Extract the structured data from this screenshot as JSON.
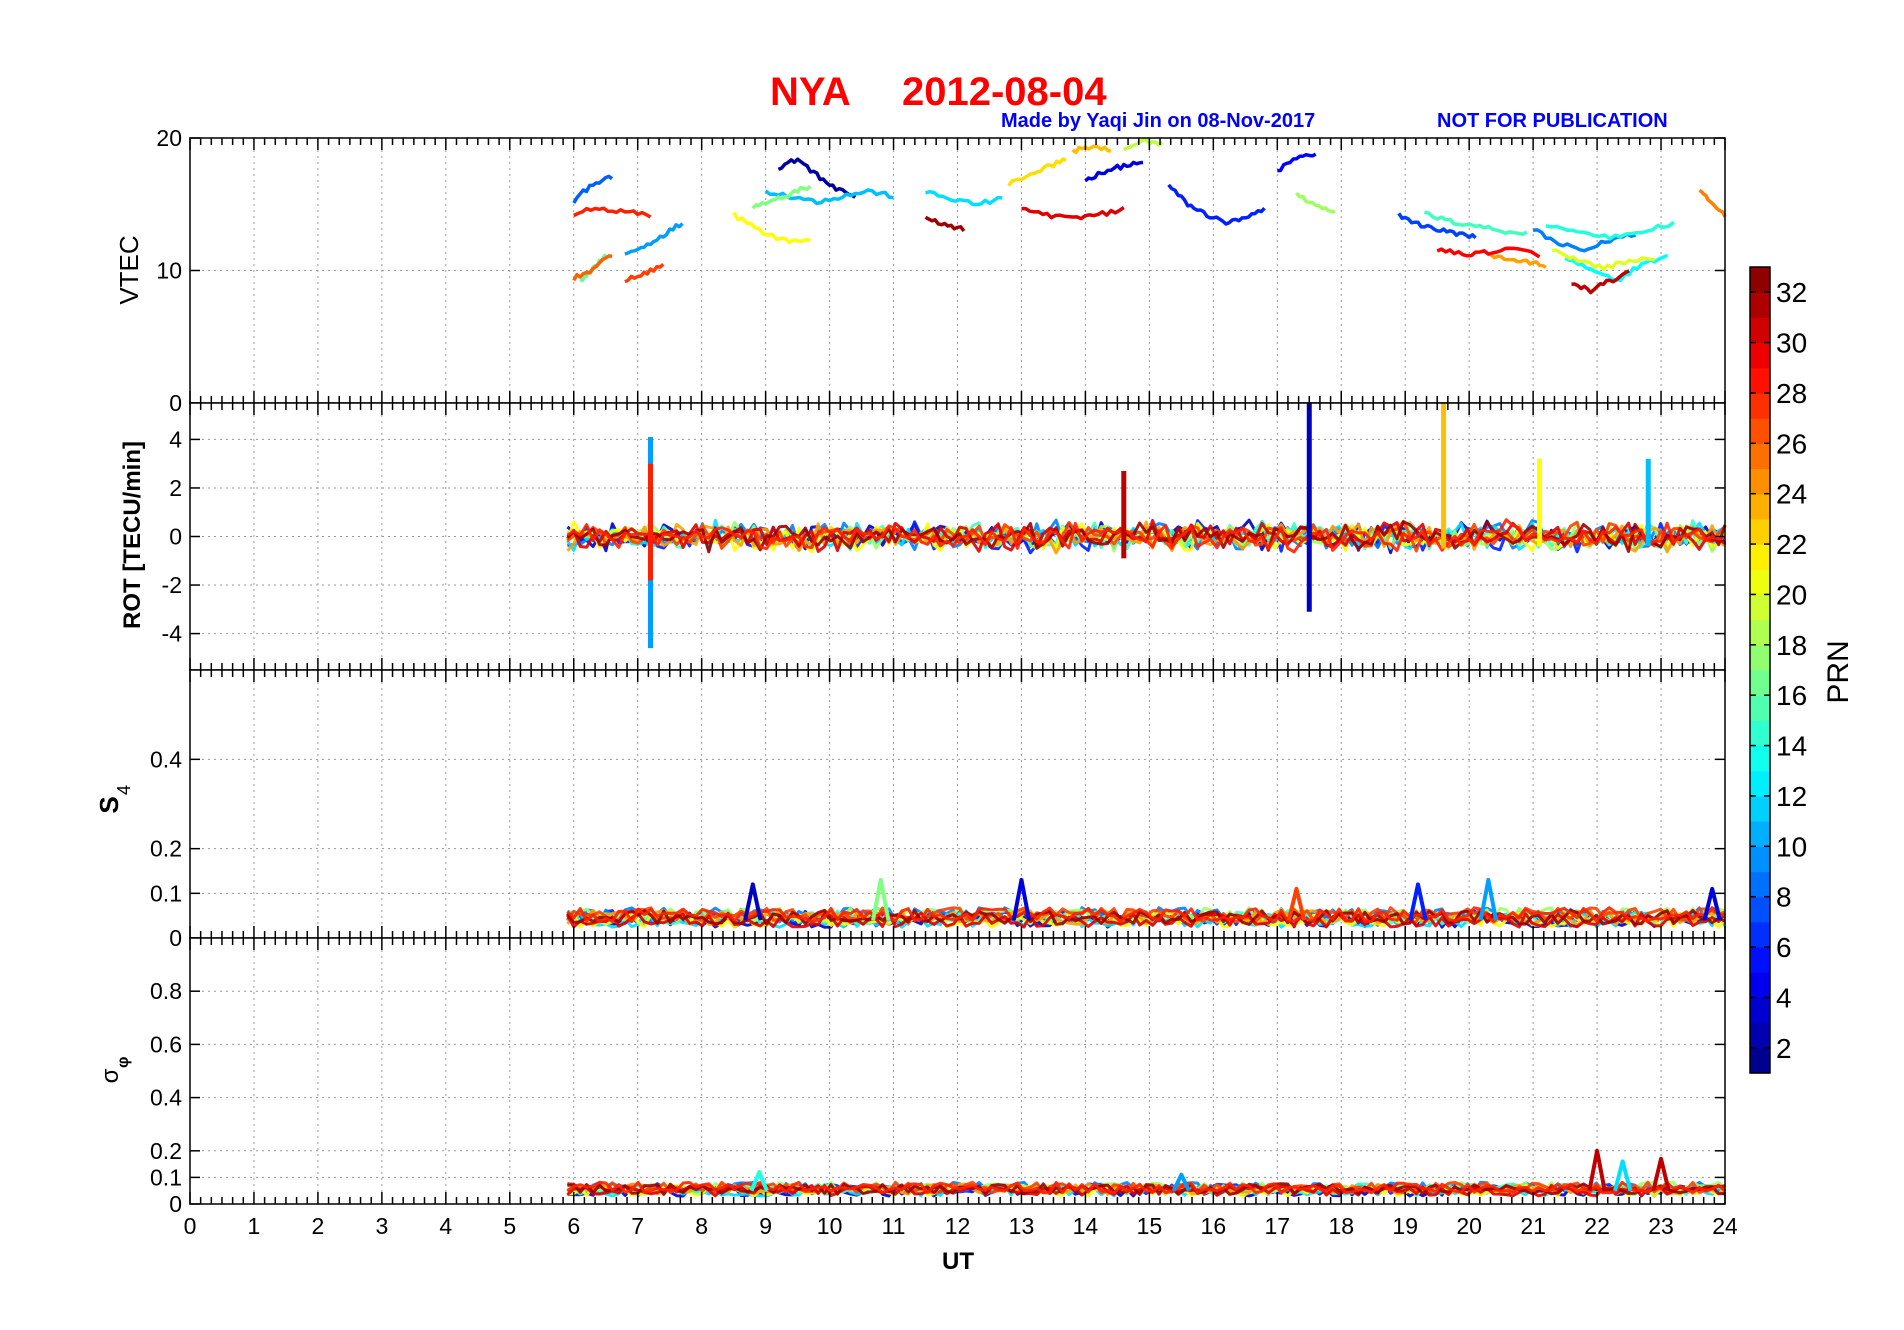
{
  "title": {
    "station": "NYA",
    "date": "2012-08-04",
    "credit": "Made by Yaqi Jin on 08-Nov-2017",
    "notice": "NOT FOR PUBLICATION"
  },
  "colors": {
    "title": "#ff0000",
    "credit": "#0000ff",
    "grid": "#9a9a9a",
    "axis": "#000000"
  },
  "colormap": "jet",
  "chart_data": [
    {
      "type": "line",
      "id": "vtec",
      "ylabel": "VTEC",
      "xlim": [
        0,
        24
      ],
      "ylim": [
        0,
        20
      ],
      "yticks": [
        "0",
        "10",
        "20"
      ],
      "ytick_values": [
        0,
        10,
        20
      ],
      "grid": true,
      "series_color_by": "PRN",
      "series": [
        {
          "prn": 2,
          "x": [
            9.2,
            9.5,
            9.8,
            10.1,
            10.4
          ],
          "y": [
            17.8,
            18.4,
            17.2,
            16.1,
            15.6
          ]
        },
        {
          "prn": 4,
          "x": [
            14.0,
            14.3,
            14.6,
            14.9
          ],
          "y": [
            16.8,
            17.5,
            17.9,
            18.1
          ]
        },
        {
          "prn": 5,
          "x": [
            17.0,
            17.3,
            17.6
          ],
          "y": [
            17.5,
            18.5,
            18.8
          ]
        },
        {
          "prn": 6,
          "x": [
            15.3,
            15.6,
            15.9,
            16.2,
            16.5,
            16.8
          ],
          "y": [
            16.4,
            15.0,
            14.2,
            13.6,
            13.9,
            14.6
          ]
        },
        {
          "prn": 7,
          "x": [
            18.9,
            19.2,
            19.5,
            19.8,
            20.1
          ],
          "y": [
            14.2,
            13.5,
            13.1,
            12.8,
            12.5
          ]
        },
        {
          "prn": 8,
          "x": [
            6.0,
            6.3,
            6.6
          ],
          "y": [
            15.2,
            16.6,
            17.0
          ]
        },
        {
          "prn": 9,
          "x": [
            21.0,
            21.4,
            21.8,
            22.2,
            22.6
          ],
          "y": [
            13.1,
            12.0,
            11.5,
            12.3,
            12.8
          ]
        },
        {
          "prn": 10,
          "x": [
            6.8,
            7.1,
            7.4,
            7.7
          ],
          "y": [
            11.2,
            11.8,
            12.7,
            13.6
          ]
        },
        {
          "prn": 11,
          "x": [
            9.0,
            9.4,
            9.8,
            10.2,
            10.6,
            11.0
          ],
          "y": [
            16.0,
            15.6,
            15.2,
            15.6,
            16.0,
            15.6
          ]
        },
        {
          "prn": 12,
          "x": [
            11.5,
            11.9,
            12.3,
            12.7
          ],
          "y": [
            15.9,
            15.4,
            15.0,
            15.4
          ]
        },
        {
          "prn": 13,
          "x": [
            21.5,
            21.9,
            22.3,
            22.7,
            23.1
          ],
          "y": [
            11.0,
            10.0,
            9.2,
            10.5,
            11.0
          ]
        },
        {
          "prn": 14,
          "x": [
            21.2,
            21.7,
            22.2,
            22.7,
            23.2
          ],
          "y": [
            13.5,
            12.9,
            12.5,
            13.0,
            13.5
          ]
        },
        {
          "prn": 15,
          "x": [
            19.3,
            19.7,
            20.1,
            20.5,
            20.9
          ],
          "y": [
            14.3,
            13.7,
            13.4,
            13.0,
            12.8
          ]
        },
        {
          "prn": 16,
          "x": [
            6.1,
            6.3,
            6.5
          ],
          "y": [
            9.2,
            10.1,
            11.2
          ]
        },
        {
          "prn": 17,
          "x": [
            8.8,
            9.1,
            9.4,
            9.7
          ],
          "y": [
            14.8,
            15.2,
            15.8,
            16.4
          ]
        },
        {
          "prn": 18,
          "x": [
            17.3,
            17.6,
            17.9
          ],
          "y": [
            15.8,
            14.8,
            14.4
          ]
        },
        {
          "prn": 19,
          "x": [
            14.6,
            14.9,
            15.2
          ],
          "y": [
            19.0,
            19.8,
            19.6
          ]
        },
        {
          "prn": 20,
          "x": [
            21.3,
            21.7,
            22.1,
            22.5,
            22.9
          ],
          "y": [
            11.6,
            10.8,
            10.2,
            10.7,
            11.0
          ]
        },
        {
          "prn": 21,
          "x": [
            8.5,
            8.9,
            9.3,
            9.7
          ],
          "y": [
            14.2,
            13.0,
            12.3,
            12.2
          ]
        },
        {
          "prn": 22,
          "x": [
            12.8,
            13.1,
            13.4,
            13.7
          ],
          "y": [
            16.5,
            17.2,
            17.8,
            18.4
          ]
        },
        {
          "prn": 23,
          "x": [
            13.8,
            14.1,
            14.4
          ],
          "y": [
            19.0,
            19.4,
            19.0
          ]
        },
        {
          "prn": 24,
          "x": [
            20.3,
            20.6,
            20.9,
            21.2
          ],
          "y": [
            11.2,
            10.9,
            10.6,
            10.4
          ]
        },
        {
          "prn": 25,
          "x": [
            23.6,
            23.8,
            24.0
          ],
          "y": [
            16.0,
            15.0,
            14.2
          ]
        },
        {
          "prn": 26,
          "x": [
            6.0,
            6.3,
            6.6
          ],
          "y": [
            9.4,
            10.1,
            11.2
          ]
        },
        {
          "prn": 27,
          "x": [
            6.8,
            7.1,
            7.4
          ],
          "y": [
            9.3,
            9.7,
            10.4
          ]
        },
        {
          "prn": 28,
          "x": [
            6.0,
            6.4,
            6.8,
            7.2
          ],
          "y": [
            14.3,
            14.7,
            14.4,
            14.2
          ]
        },
        {
          "prn": 29,
          "x": [
            19.5,
            19.9,
            20.3,
            20.7,
            21.1
          ],
          "y": [
            11.6,
            11.2,
            11.4,
            11.6,
            11.2
          ]
        },
        {
          "prn": 30,
          "x": [
            13.0,
            13.4,
            13.8,
            14.2,
            14.6
          ],
          "y": [
            14.6,
            14.2,
            13.9,
            14.2,
            14.6
          ]
        },
        {
          "prn": 31,
          "x": [
            21.6,
            21.9,
            22.2,
            22.5
          ],
          "y": [
            9.0,
            8.5,
            9.2,
            9.8
          ]
        },
        {
          "prn": 32,
          "x": [
            11.5,
            11.8,
            12.1
          ],
          "y": [
            13.9,
            13.5,
            13.1
          ]
        }
      ]
    },
    {
      "type": "line",
      "id": "rot",
      "ylabel": "ROT [TECU/min]",
      "xlim": [
        0,
        24
      ],
      "ylim": [
        -5.5,
        5.5
      ],
      "yticks": [
        "-4",
        "-2",
        "0",
        "2",
        "4"
      ],
      "ytick_values": [
        -4,
        -2,
        0,
        2,
        4
      ],
      "grid": true,
      "data_x_range": [
        5.9,
        24
      ],
      "noise_amplitude": 0.5,
      "spikes": [
        {
          "x": 7.2,
          "ymin": -4.6,
          "ymax": 4.1,
          "prn": 10
        },
        {
          "x": 7.2,
          "ymin": -1.8,
          "ymax": 3.0,
          "prn": 28
        },
        {
          "x": 14.6,
          "ymin": -0.9,
          "ymax": 2.7,
          "prn": 31
        },
        {
          "x": 17.5,
          "ymin": -3.1,
          "ymax": 5.5,
          "prn": 3
        },
        {
          "x": 19.6,
          "ymin": -0.5,
          "ymax": 5.5,
          "prn": 23
        },
        {
          "x": 21.1,
          "ymin": -0.4,
          "ymax": 3.2,
          "prn": 21
        },
        {
          "x": 22.8,
          "ymin": -0.4,
          "ymax": 3.2,
          "prn": 11
        }
      ]
    },
    {
      "type": "line",
      "id": "s4",
      "ylabel": "S4",
      "xlim": [
        0,
        24
      ],
      "ylim": [
        0,
        0.6
      ],
      "yticks": [
        "0",
        "0.1",
        "0.2",
        "0.4"
      ],
      "ytick_values": [
        0,
        0.1,
        0.2,
        0.4
      ],
      "grid": true,
      "data_x_range": [
        5.9,
        24
      ],
      "baseline": 0.04,
      "peaks": [
        {
          "x": 8.8,
          "y": 0.12,
          "prn": 3
        },
        {
          "x": 10.8,
          "y": 0.13,
          "prn": 17
        },
        {
          "x": 13.0,
          "y": 0.13,
          "prn": 4
        },
        {
          "x": 17.3,
          "y": 0.11,
          "prn": 27
        },
        {
          "x": 19.2,
          "y": 0.12,
          "prn": 6
        },
        {
          "x": 20.3,
          "y": 0.13,
          "prn": 10
        },
        {
          "x": 23.8,
          "y": 0.11,
          "prn": 4
        }
      ]
    },
    {
      "type": "line",
      "id": "sigma_phi",
      "ylabel": "σφ",
      "xlabel": "UT",
      "xlim": [
        0,
        24
      ],
      "ylim": [
        0,
        1.0
      ],
      "yticks": [
        "0",
        "0.1",
        "0.2",
        "0.4",
        "0.6",
        "0.8"
      ],
      "ytick_values": [
        0,
        0.1,
        0.2,
        0.4,
        0.6,
        0.8
      ],
      "xticks": [
        "0",
        "1",
        "2",
        "3",
        "4",
        "5",
        "6",
        "7",
        "8",
        "9",
        "10",
        "11",
        "12",
        "13",
        "14",
        "15",
        "16",
        "17",
        "18",
        "19",
        "20",
        "21",
        "22",
        "23",
        "24"
      ],
      "grid": true,
      "data_x_range": [
        5.9,
        24
      ],
      "baseline": 0.05,
      "peaks": [
        {
          "x": 8.9,
          "y": 0.12,
          "prn": 14
        },
        {
          "x": 15.5,
          "y": 0.11,
          "prn": 10
        },
        {
          "x": 22.0,
          "y": 0.2,
          "prn": 31
        },
        {
          "x": 22.4,
          "y": 0.16,
          "prn": 12
        },
        {
          "x": 23.0,
          "y": 0.17,
          "prn": 31
        }
      ]
    }
  ],
  "colorbar": {
    "label": "PRN",
    "range": [
      1,
      33
    ],
    "ticks": [
      "2",
      "4",
      "6",
      "8",
      "10",
      "12",
      "14",
      "16",
      "18",
      "20",
      "22",
      "24",
      "26",
      "28",
      "30",
      "32"
    ],
    "tick_values": [
      2,
      4,
      6,
      8,
      10,
      12,
      14,
      16,
      18,
      20,
      22,
      24,
      26,
      28,
      30,
      32
    ]
  }
}
